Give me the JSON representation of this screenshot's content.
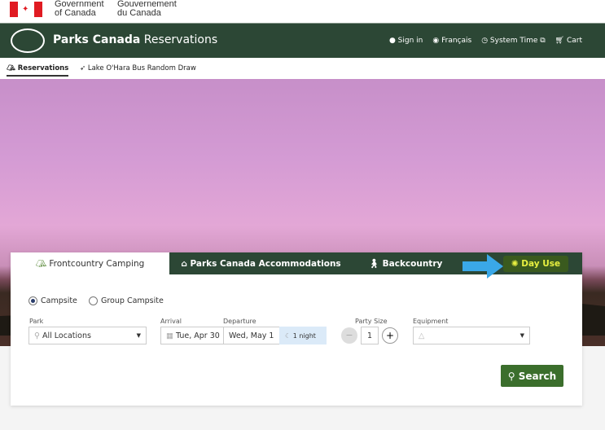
{
  "gov": {
    "en1": "Government",
    "en2": "of Canada",
    "fr1": "Gouvernement",
    "fr2": "du Canada"
  },
  "header": {
    "brand_bold": "Parks Canada",
    "brand_rest": " Reservations",
    "signin": "Sign in",
    "lang": "Français",
    "time": "System Time",
    "cart": "Cart"
  },
  "subnav": {
    "reservations": "Reservations",
    "lake": "Lake O'Hara Bus Random Draw"
  },
  "tabs": {
    "front": "Frontcountry Camping",
    "accom": "Parks Canada Accommodations",
    "back": "Backcountry",
    "day": "Day Use"
  },
  "form": {
    "campsite": "Campsite",
    "group": "Group Campsite",
    "park_label": "Park",
    "park_value": "All Locations",
    "arrival_label": "Arrival",
    "arrival": "Tue, Apr 30",
    "departure_label": "Departure",
    "departure": "Wed, May 1",
    "nights": "1 night",
    "party_label": "Party Size",
    "party": "1",
    "equip_label": "Equipment",
    "search": "Search"
  }
}
